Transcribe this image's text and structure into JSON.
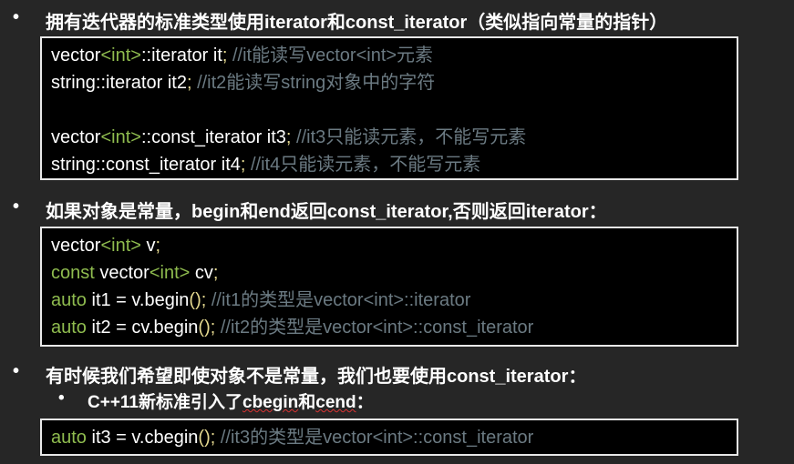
{
  "bullets": [
    "拥有迭代器的标准类型使用iterator和const_iterator（类似指向常量的指针）",
    "如果对象是常量，begin和end返回const_iterator,否则返回iterator：",
    "有时候我们希望即使对象不是常量，我们也要使用const_iterator："
  ],
  "sub_bullet": {
    "prefix": "C++11新标准引入了",
    "a": "cbegin",
    "mid": "和",
    "b": "cend",
    "suffix": "："
  },
  "bullet_symbol": "•",
  "box1": [
    [
      {
        "t": "vector",
        "c": "plain"
      },
      {
        "t": "<int>",
        "c": "kw"
      },
      {
        "t": "::iterator it",
        "c": "plain"
      },
      {
        "t": ";",
        "c": "punct"
      },
      {
        "t": " //it能读写vector<int>元素",
        "c": "comment"
      }
    ],
    [
      {
        "t": "string::iterator it2",
        "c": "plain"
      },
      {
        "t": ";",
        "c": "punct"
      },
      {
        "t": " //it2能读写string对象中的字符",
        "c": "comment"
      }
    ],
    [],
    [
      {
        "t": "vector",
        "c": "plain"
      },
      {
        "t": "<int>",
        "c": "kw"
      },
      {
        "t": "::const_iterator it3",
        "c": "plain"
      },
      {
        "t": ";",
        "c": "punct"
      },
      {
        "t": " //it3只能读元素，不能写元素",
        "c": "comment"
      }
    ],
    [
      {
        "t": "string::const_iterator it4",
        "c": "plain"
      },
      {
        "t": ";",
        "c": "punct"
      },
      {
        "t": " //it4只能读元素，不能写元素",
        "c": "comment"
      }
    ]
  ],
  "box2": [
    [
      {
        "t": "vector",
        "c": "plain"
      },
      {
        "t": "<int>",
        "c": "kw"
      },
      {
        "t": " v",
        "c": "plain"
      },
      {
        "t": ";",
        "c": "punct"
      }
    ],
    [
      {
        "t": "const",
        "c": "kw"
      },
      {
        "t": " vector",
        "c": "plain"
      },
      {
        "t": "<int>",
        "c": "kw"
      },
      {
        "t": " cv",
        "c": "plain"
      },
      {
        "t": ";",
        "c": "punct"
      }
    ],
    [
      {
        "t": "auto",
        "c": "kw"
      },
      {
        "t": " it1 = v.begin",
        "c": "plain"
      },
      {
        "t": "();",
        "c": "punct"
      },
      {
        "t": " //it1的类型是vector<int>::iterator",
        "c": "comment"
      }
    ],
    [
      {
        "t": "auto",
        "c": "kw"
      },
      {
        "t": " it2 = cv.begin",
        "c": "plain"
      },
      {
        "t": "();",
        "c": "punct"
      },
      {
        "t": " //it2的类型是vector<int>::const_iterator",
        "c": "comment"
      }
    ]
  ],
  "box3": [
    [
      {
        "t": "auto",
        "c": "kw"
      },
      {
        "t": " it3 = v.cbegin",
        "c": "plain"
      },
      {
        "t": "();",
        "c": "punct"
      },
      {
        "t": " //it3的类型是vector<int>::const_iterator",
        "c": "comment"
      }
    ]
  ],
  "colors": {
    "background": "#262626",
    "keyword": "#8fbc4f",
    "punct": "#e4d88f",
    "comment": "#6b7a82"
  }
}
